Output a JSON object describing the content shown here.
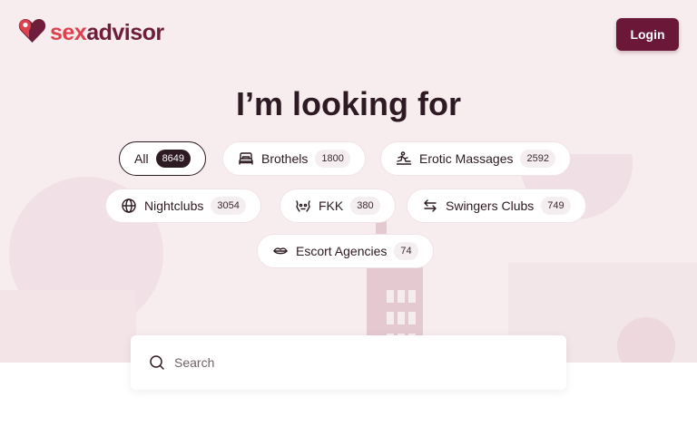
{
  "brand": {
    "logo_part1": "sex",
    "logo_part2": "advisor"
  },
  "header": {
    "login_label": "Login"
  },
  "hero": {
    "title": "I’m looking for"
  },
  "categories": [
    {
      "label": "All",
      "count": "8649",
      "icon": "none",
      "active": true
    },
    {
      "label": "Brothels",
      "count": "1800",
      "icon": "bed-icon"
    },
    {
      "label": "Erotic Massages",
      "count": "2592",
      "icon": "massage-icon"
    },
    {
      "label": "Nightclubs",
      "count": "3054",
      "icon": "globe-icon"
    },
    {
      "label": "FKK",
      "count": "380",
      "icon": "sauna-icon"
    },
    {
      "label": "Swingers Clubs",
      "count": "749",
      "icon": "swap-arrows-icon"
    },
    {
      "label": "Escort Agencies",
      "count": "74",
      "icon": "lips-icon"
    }
  ],
  "search": {
    "placeholder": "Search",
    "value": ""
  },
  "colors": {
    "brand_red": "#e0404e",
    "brand_maroon": "#6e1d3b",
    "login_bg": "#6b1838",
    "hero_bg": "#f7ecee",
    "active_count_bg": "#2d1a22"
  }
}
